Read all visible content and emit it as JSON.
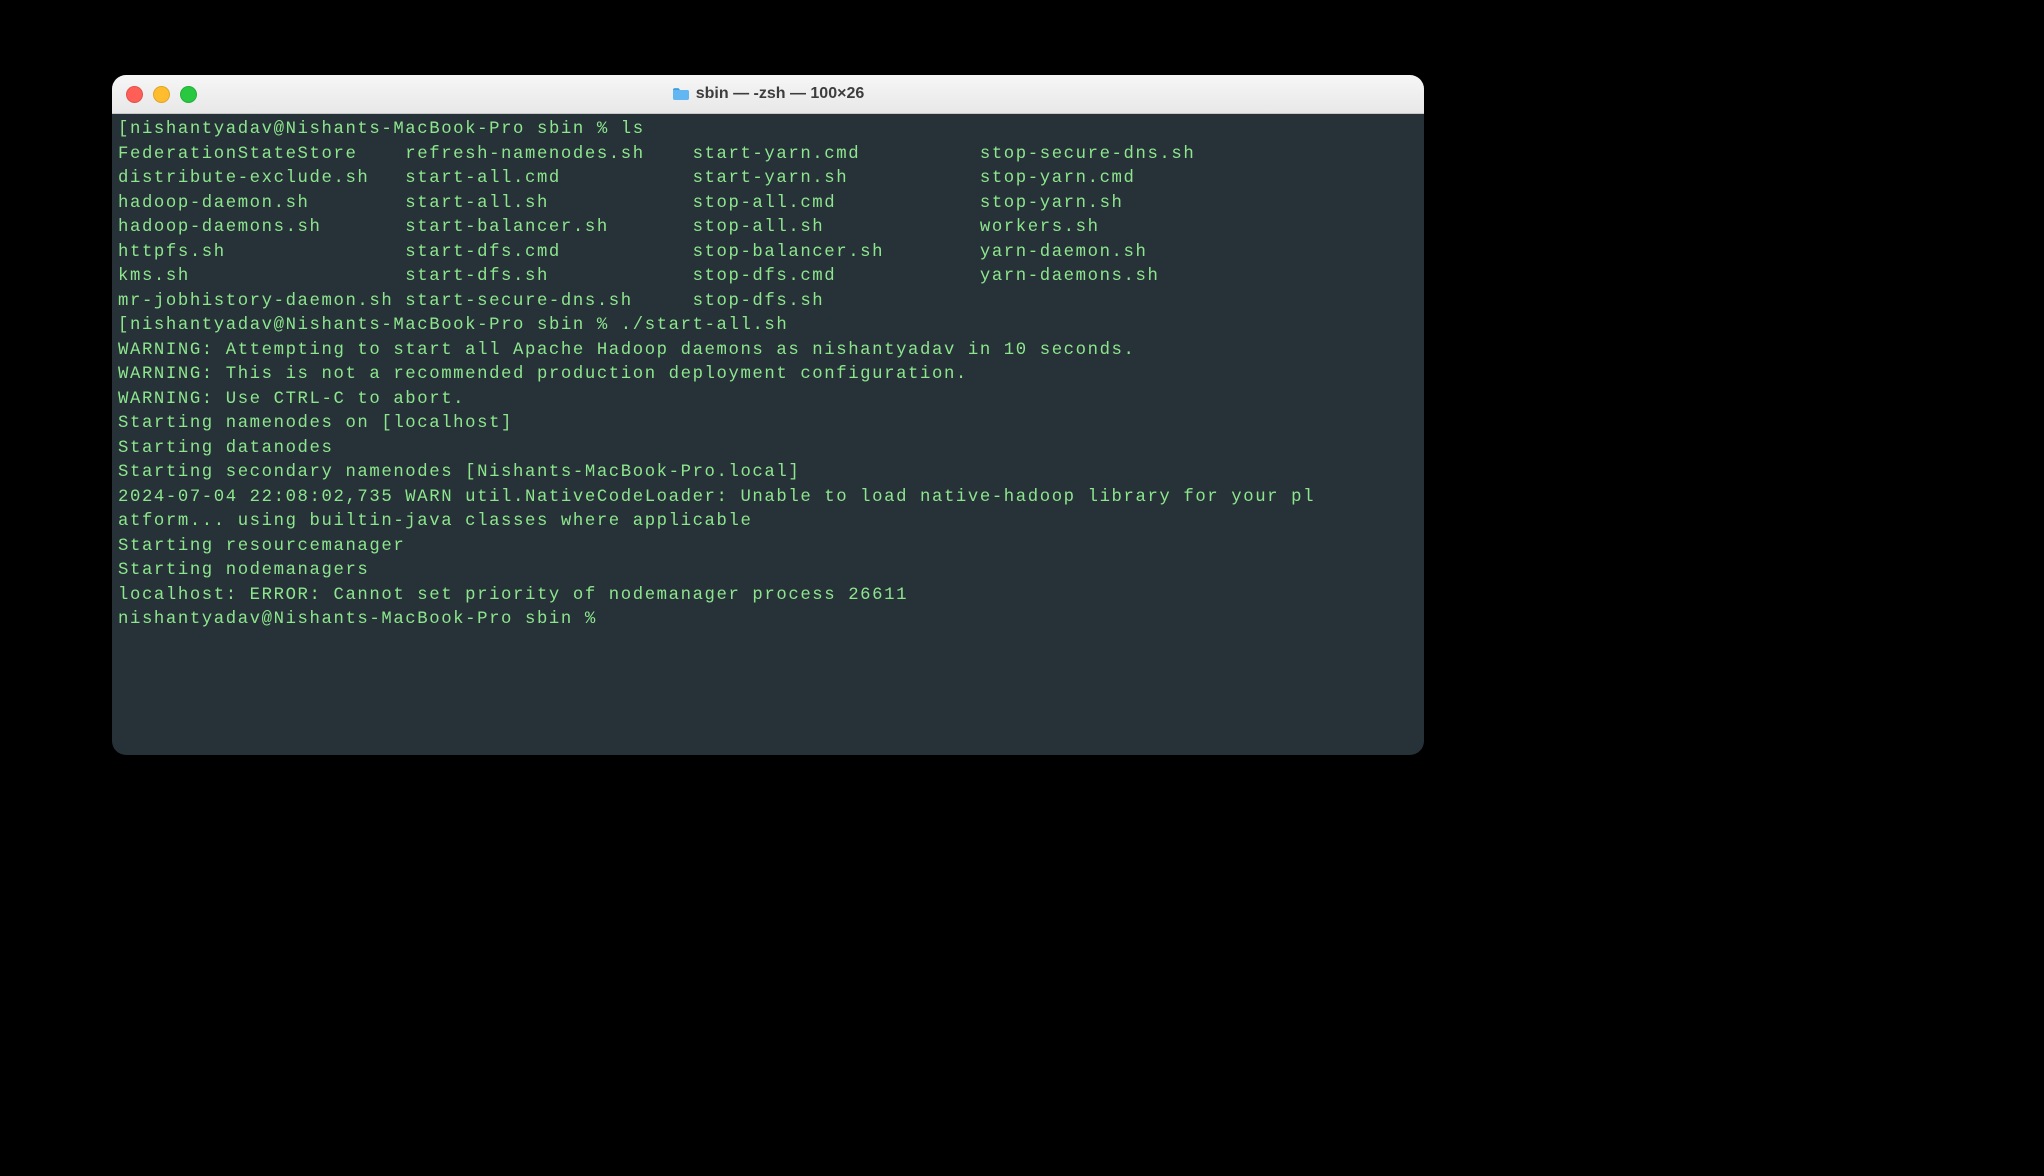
{
  "window": {
    "title": "sbin — -zsh — 100×26"
  },
  "prompt1": {
    "open": "[",
    "userhost": "nishantyadav@Nishants-MacBook-Pro sbin % ",
    "cmd": "ls",
    "close": ""
  },
  "ls": {
    "rows": [
      [
        "FederationStateStore",
        "refresh-namenodes.sh",
        "start-yarn.cmd",
        "stop-secure-dns.sh"
      ],
      [
        "distribute-exclude.sh",
        "start-all.cmd",
        "start-yarn.sh",
        "stop-yarn.cmd"
      ],
      [
        "hadoop-daemon.sh",
        "start-all.sh",
        "stop-all.cmd",
        "stop-yarn.sh"
      ],
      [
        "hadoop-daemons.sh",
        "start-balancer.sh",
        "stop-all.sh",
        "workers.sh"
      ],
      [
        "httpfs.sh",
        "start-dfs.cmd",
        "stop-balancer.sh",
        "yarn-daemon.sh"
      ],
      [
        "kms.sh",
        "start-dfs.sh",
        "stop-dfs.cmd",
        "yarn-daemons.sh"
      ],
      [
        "mr-jobhistory-daemon.sh",
        "start-secure-dns.sh",
        "stop-dfs.sh",
        ""
      ]
    ]
  },
  "prompt2": {
    "open": "[",
    "userhost": "nishantyadav@Nishants-MacBook-Pro sbin % ",
    "cmd": "./start-all.sh",
    "close": ""
  },
  "output": [
    "WARNING: Attempting to start all Apache Hadoop daemons as nishantyadav in 10 seconds.",
    "WARNING: This is not a recommended production deployment configuration.",
    "WARNING: Use CTRL-C to abort.",
    "Starting namenodes on [localhost]",
    "Starting datanodes",
    "Starting secondary namenodes [Nishants-MacBook-Pro.local]",
    "2024-07-04 22:08:02,735 WARN util.NativeCodeLoader: Unable to load native-hadoop library for your platform... using builtin-java classes where applicable",
    "Starting resourcemanager",
    "Starting nodemanagers",
    "localhost: ERROR: Cannot set priority of nodemanager process 26611"
  ],
  "prompt3": {
    "text": "nishantyadav@Nishants-MacBook-Pro sbin % "
  }
}
